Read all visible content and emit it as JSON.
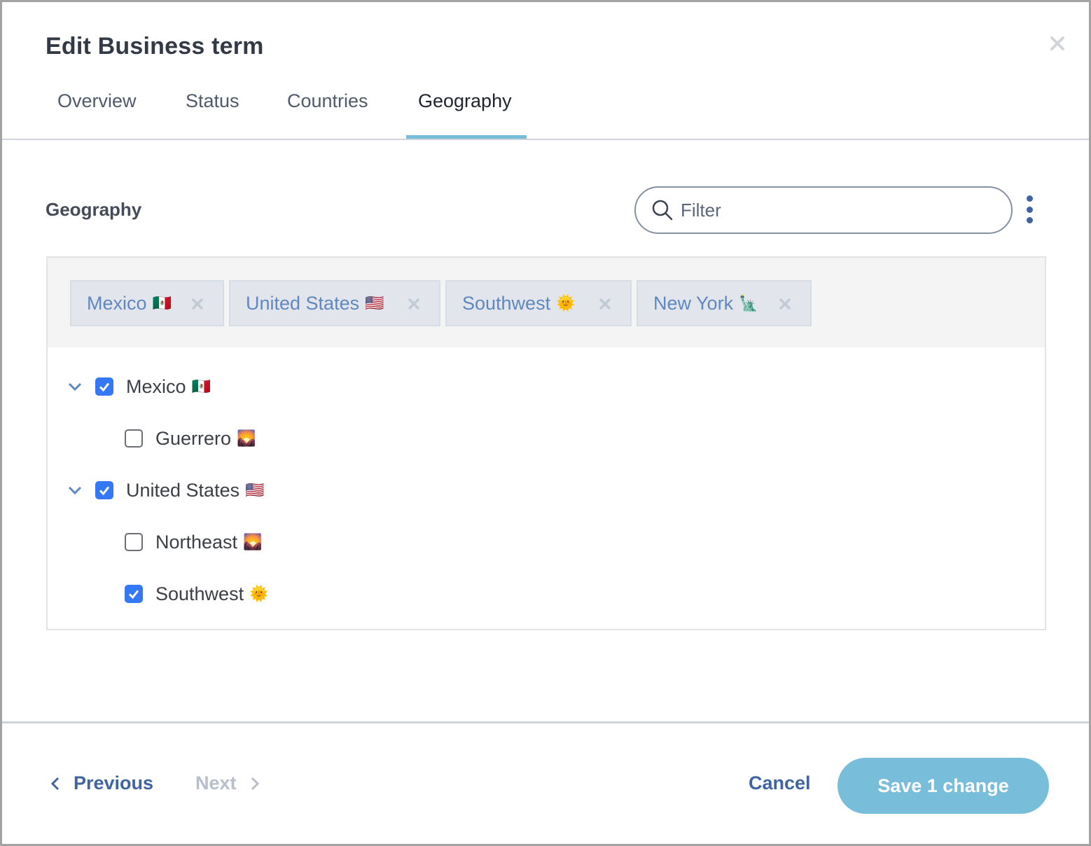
{
  "dialog": {
    "title": "Edit Business term",
    "close_icon": "close-icon"
  },
  "tabs": [
    {
      "label": "Overview",
      "active": false
    },
    {
      "label": "Status",
      "active": false
    },
    {
      "label": "Countries",
      "active": false
    },
    {
      "label": "Geography",
      "active": true
    }
  ],
  "section": {
    "title": "Geography",
    "filter": {
      "value": "",
      "placeholder": "Filter",
      "icon": "search-icon"
    },
    "menu_icon": "kebab-menu-icon"
  },
  "chips": [
    {
      "label": "Mexico",
      "emoji": "🇲🇽"
    },
    {
      "label": "United States",
      "emoji": "🇺🇸"
    },
    {
      "label": "Southwest",
      "emoji": "🌞"
    },
    {
      "label": "New York",
      "emoji": "🗽"
    }
  ],
  "tree": [
    {
      "label": "Mexico",
      "emoji": "🇲🇽",
      "checked": true,
      "expanded": true,
      "level": 0
    },
    {
      "label": "Guerrero",
      "emoji": "🌄",
      "checked": false,
      "level": 1
    },
    {
      "label": "United States",
      "emoji": "🇺🇸",
      "checked": true,
      "expanded": true,
      "level": 0
    },
    {
      "label": "Northeast",
      "emoji": "🌄",
      "checked": false,
      "level": 1
    },
    {
      "label": "Southwest",
      "emoji": "🌞",
      "checked": true,
      "level": 1
    }
  ],
  "footer": {
    "previous_label": "Previous",
    "next_label": "Next",
    "next_disabled": true,
    "cancel_label": "Cancel",
    "save_label": "Save 1 change"
  },
  "colors": {
    "accent": "#76bdd9",
    "link": "#3f64a0",
    "checkbox": "#3478f6",
    "chip_text": "#5f87c0",
    "disabled": "#b7bfca"
  }
}
